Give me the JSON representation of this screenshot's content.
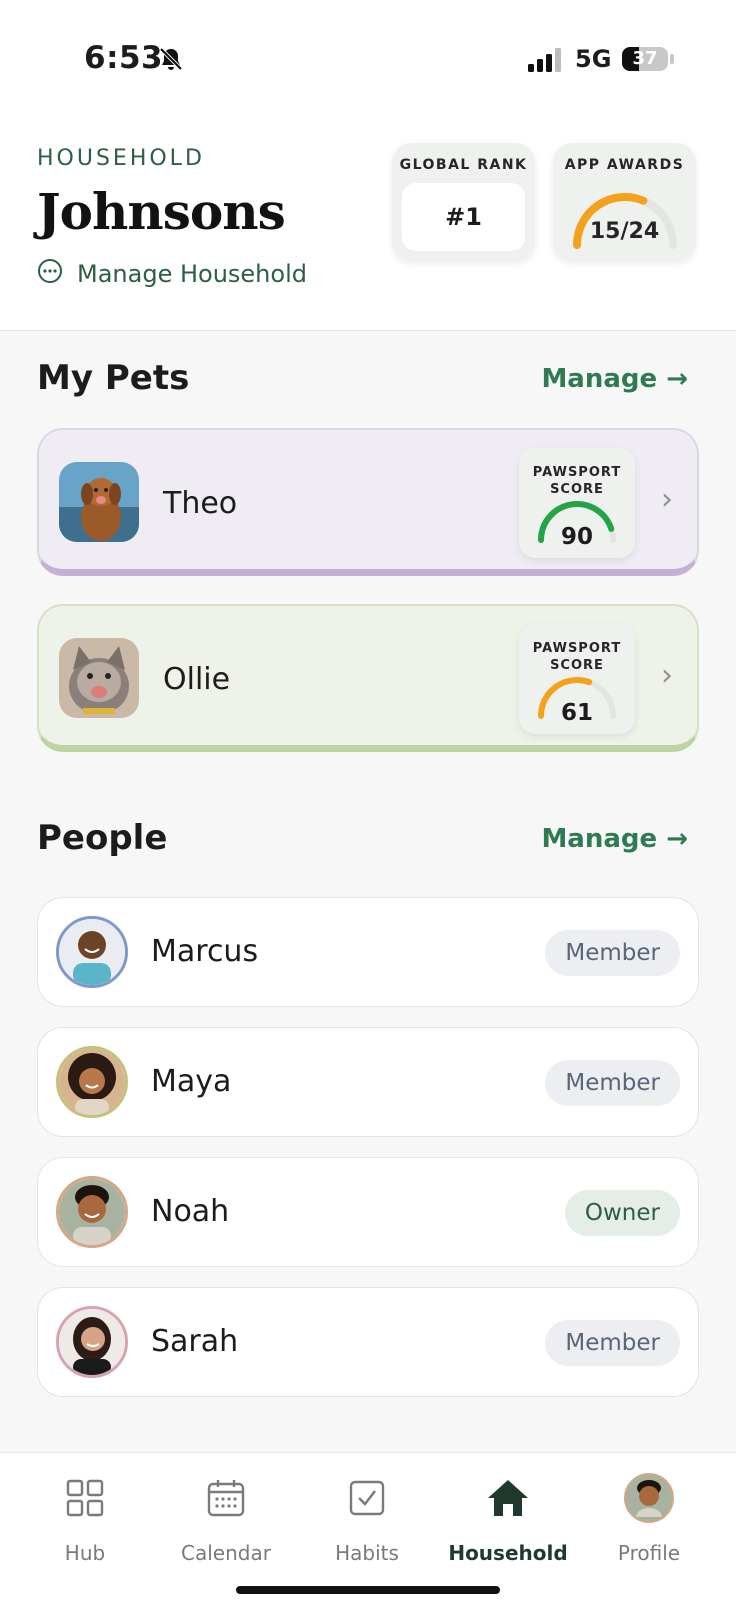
{
  "status_bar": {
    "time": "6:53",
    "network": "5G",
    "battery": "37",
    "battery_level": 0.37
  },
  "header": {
    "label": "HOUSEHOLD",
    "name": "Johnsons",
    "manage_label": "Manage Household",
    "global_rank": {
      "label": "GLOBAL RANK",
      "value": "#1"
    },
    "app_awards": {
      "label": "APP AWARDS",
      "value": "15/24",
      "progress": 0.625
    }
  },
  "colors": {
    "accent": "#2e7a52",
    "dark_green": "#2e5e44",
    "gauge_green": "#22a447",
    "gauge_orange": "#f4a21b"
  },
  "pets": {
    "title": "My Pets",
    "manage_label": "Manage →",
    "items": [
      {
        "name": "Theo",
        "score_label": "PAWSPORT SCORE",
        "score": "90",
        "score_fraction": 0.9,
        "avatar": "dog-photo"
      },
      {
        "name": "Ollie",
        "score_label": "PAWSPORT SCORE",
        "score": "61",
        "score_fraction": 0.61,
        "avatar": "cat-photo"
      }
    ]
  },
  "people": {
    "title": "People",
    "manage_label": "Manage →",
    "items": [
      {
        "name": "Marcus",
        "role": "Member"
      },
      {
        "name": "Maya",
        "role": "Member"
      },
      {
        "name": "Noah",
        "role": "Owner"
      },
      {
        "name": "Sarah",
        "role": "Member"
      }
    ]
  },
  "tabbar": {
    "items": [
      {
        "label": "Hub",
        "icon": "grid-icon"
      },
      {
        "label": "Calendar",
        "icon": "calendar-icon"
      },
      {
        "label": "Habits",
        "icon": "checkbox-icon"
      },
      {
        "label": "Household",
        "icon": "home-icon",
        "active": true
      },
      {
        "label": "Profile",
        "icon": "profile-avatar"
      }
    ]
  }
}
